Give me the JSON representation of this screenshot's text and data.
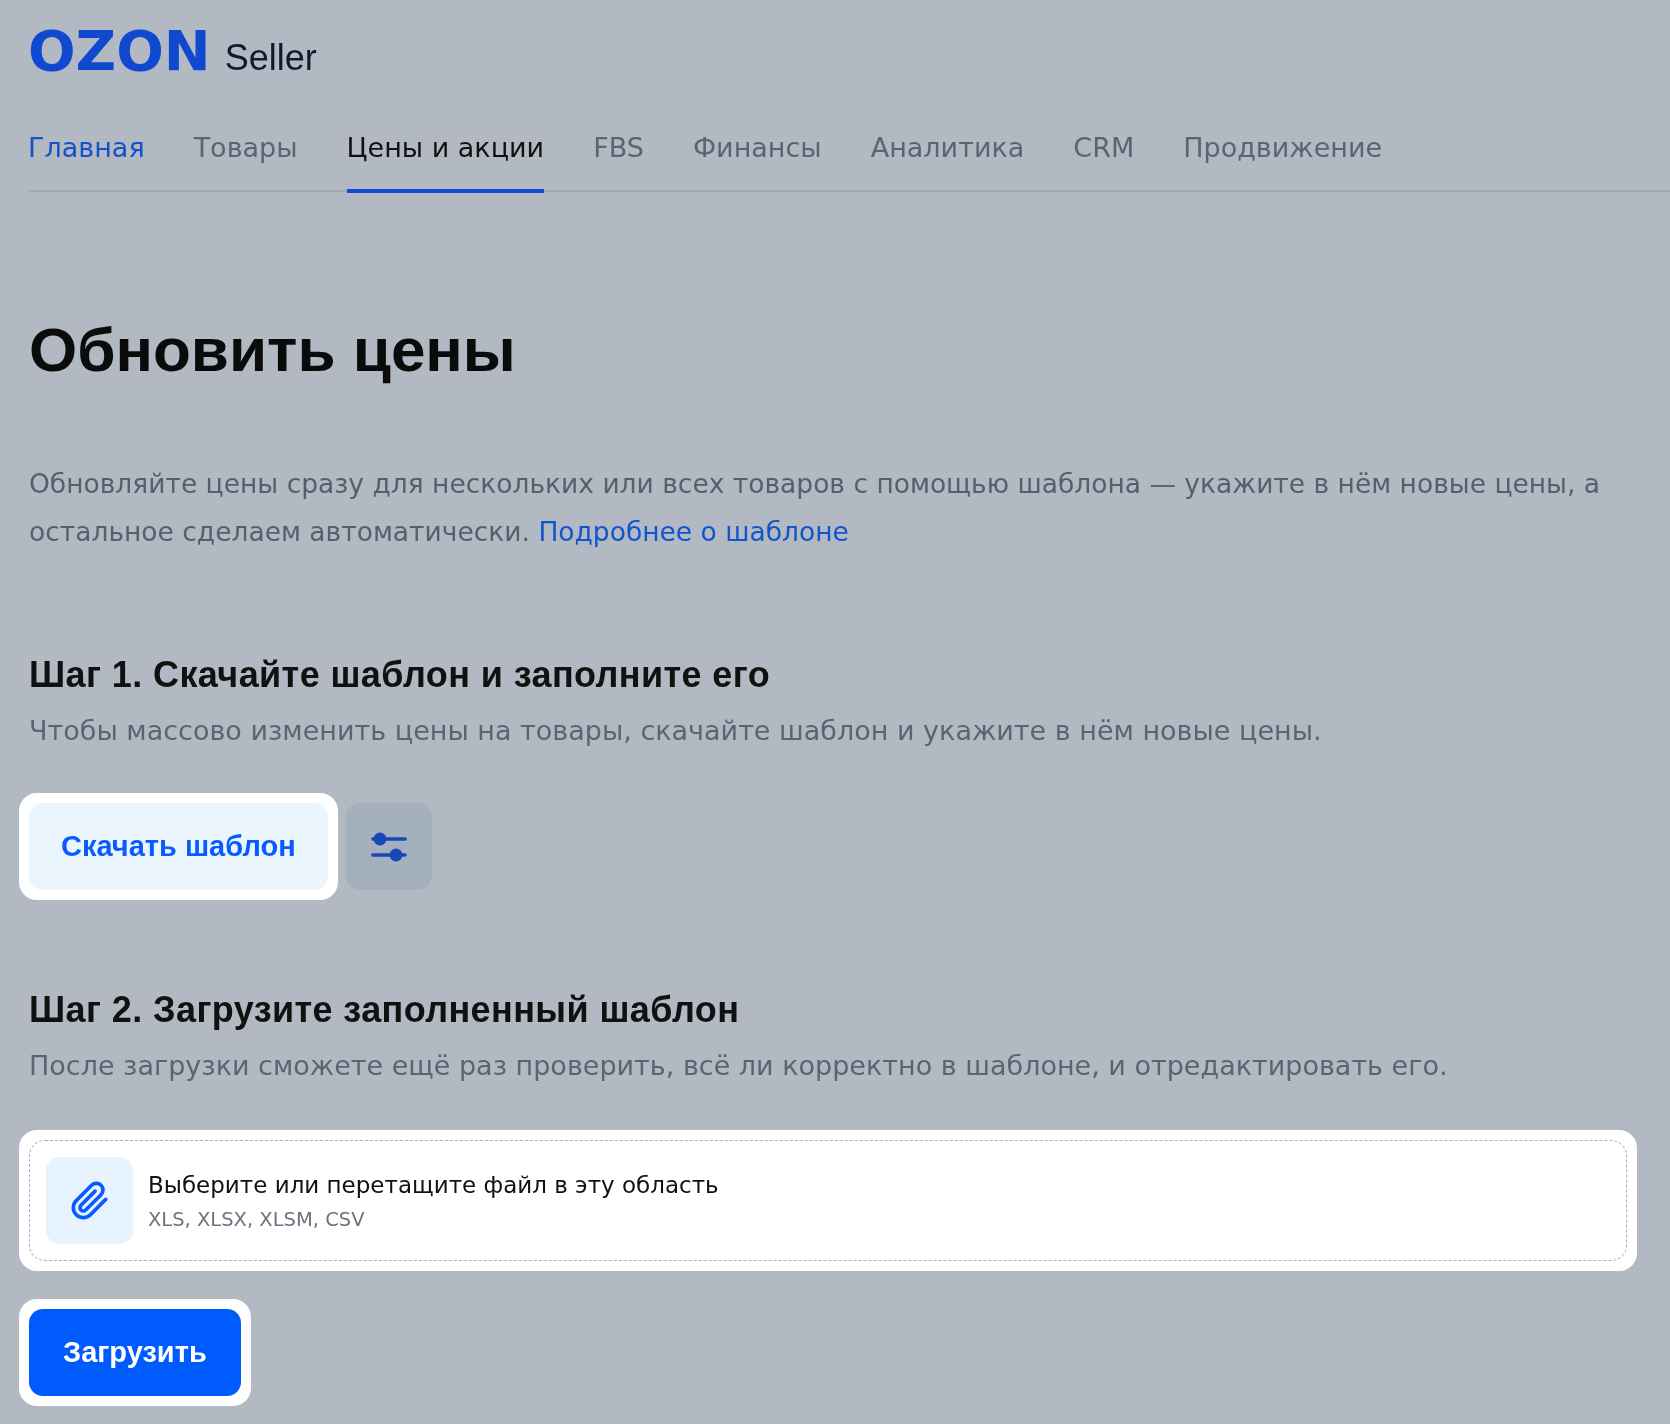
{
  "header": {
    "logo": {
      "brand": "OZON",
      "product": "Seller"
    },
    "tabs": [
      {
        "label": "Главная",
        "selected": false,
        "hovered": true
      },
      {
        "label": "Товары",
        "selected": false,
        "hovered": false
      },
      {
        "label": "Цены и акции",
        "selected": true,
        "hovered": false
      },
      {
        "label": "FBS",
        "selected": false,
        "hovered": false
      },
      {
        "label": "Финансы",
        "selected": false,
        "hovered": false
      },
      {
        "label": "Аналитика",
        "selected": false,
        "hovered": false
      },
      {
        "label": "CRM",
        "selected": false,
        "hovered": false
      },
      {
        "label": "Продвижение",
        "selected": false,
        "hovered": false
      }
    ]
  },
  "page": {
    "title": "Обновить цены",
    "intro": {
      "text": "Обновляйте цены сразу для нескольких или всех товаров с помощью шаблона — укажите в нём новые цены, а остальное сделаем автоматически.",
      "link": "Подробнее о шаблоне"
    }
  },
  "steps": [
    {
      "kind": "download",
      "title": "Шаг 1. Скачайте шаблон и заполните его",
      "description": "Чтобы массово изменить цены на товары, скачайте шаблон и укажите в нём новые цены.",
      "actions": [
        {
          "kind": "text-button",
          "label": "Скачать шаблон",
          "highlighted": true
        },
        {
          "kind": "icon-button",
          "highlighted": false
        }
      ]
    },
    {
      "kind": "upload",
      "title": "Шаг 2. Загрузите заполненный шаблон",
      "description": "После загрузки сможете ещё раз проверить, всё ли корректно в шаблоне, и отредактировать его.",
      "dropzone": {
        "hint": "Выберите или перетащите файл в эту область",
        "formats": "XLS, XLSX, XLSM, CSV",
        "highlighted": true
      }
    }
  ],
  "submit": {
    "label": "Загрузить",
    "highlighted": true
  }
}
